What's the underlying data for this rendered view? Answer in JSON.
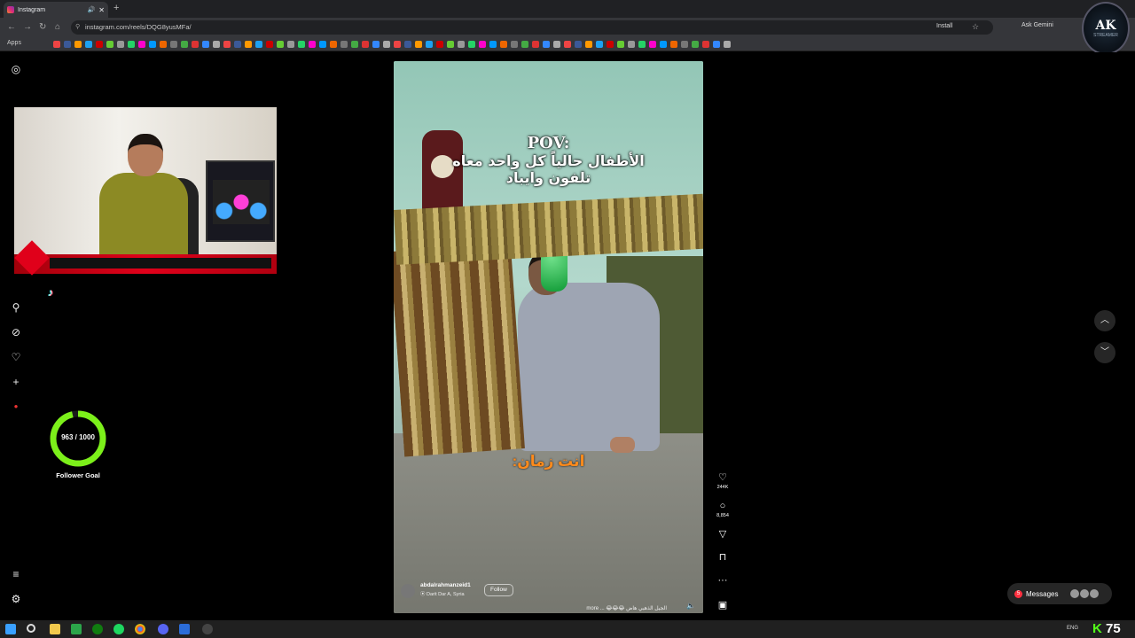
{
  "browser": {
    "tab_title": "Instagram",
    "new_tab": "+",
    "url": "instagram.com/reels/DQG8yusMFa/",
    "install_label": "Install",
    "gemini_label": "Ask Gemini",
    "apps_label": "Apps"
  },
  "logo": {
    "text": "AK",
    "subtext": "STREAMER"
  },
  "overlay": {
    "goal_value": "963 / 1000",
    "goal_current": 963,
    "goal_target": 1000,
    "goal_label": "Follower Goal",
    "goal_color": "#7cf01a"
  },
  "reel": {
    "pov_title": "POV:",
    "pov_line1": "الأطفال حالياً كل واحد معاه",
    "pov_line2": "تلفون وايباد",
    "subtitle": "انت زمان:",
    "username": "abdalrahmanzeid1",
    "location": "Darit Dar A, Syria",
    "follow_label": "Follow",
    "caption": "الجيل الذهبي هاض 😂😂😂 ... more"
  },
  "actions": {
    "likes": "244K",
    "comments": "8,854"
  },
  "messages": {
    "label": "Messages",
    "badge": "5"
  },
  "taskbar": {
    "lang": "ENG",
    "kick_count": "75"
  }
}
